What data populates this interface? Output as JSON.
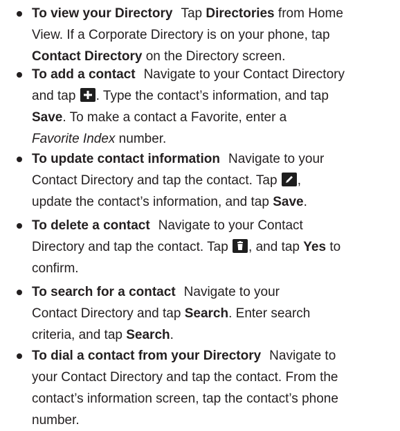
{
  "items": [
    {
      "heading": "To view your Directory",
      "l1": "Tap ",
      "l1b": "Directories",
      "l1c": " from Home",
      "l2": "View. If a Corporate Directory is on your phone, tap",
      "l3b": "Contact Directory",
      "l3": " on the Directory screen."
    },
    {
      "heading": "To add a contact",
      "l1": "Navigate to your Contact Directory",
      "l2a": "and tap ",
      "l2c": ". Type the contact’s information, and tap",
      "l3b": "Save",
      "l3": ". To make a contact a Favorite, enter a",
      "l4i": "Favorite Index",
      "l4": " number."
    },
    {
      "heading": "To update contact information",
      "l1": "Navigate to your",
      "l2": "Contact Directory and tap the contact. Tap ",
      "l2c": ",",
      "l3": "update the contact’s information, and tap ",
      "l3b": "Save",
      "l3e": "."
    },
    {
      "heading": "To delete a contact",
      "l1": "Navigate to your Contact",
      "l2": "Directory and tap the contact. Tap ",
      "l2c": ", and tap ",
      "l2b": "Yes",
      "l2e": " to",
      "l3": "confirm."
    },
    {
      "heading": "To search for a contact",
      "l1": "Navigate to your",
      "l2": "Contact Directory and tap ",
      "l2b": "Search",
      "l2e": ". Enter search",
      "l3": "criteria, and tap ",
      "l3b": "Search",
      "l3e": "."
    },
    {
      "heading": "To dial a contact from your Directory",
      "l1": "Navigate to",
      "l2": "your Contact Directory and tap the contact. From the",
      "l3": "contact’s information screen, tap the contact’s phone",
      "l4": "number."
    }
  ],
  "icons": {
    "add": "plus-icon",
    "edit": "pencil-icon",
    "delete": "trash-icon"
  },
  "colors": {
    "text": "#231f20",
    "icon_bg": "#1e1e1e"
  }
}
